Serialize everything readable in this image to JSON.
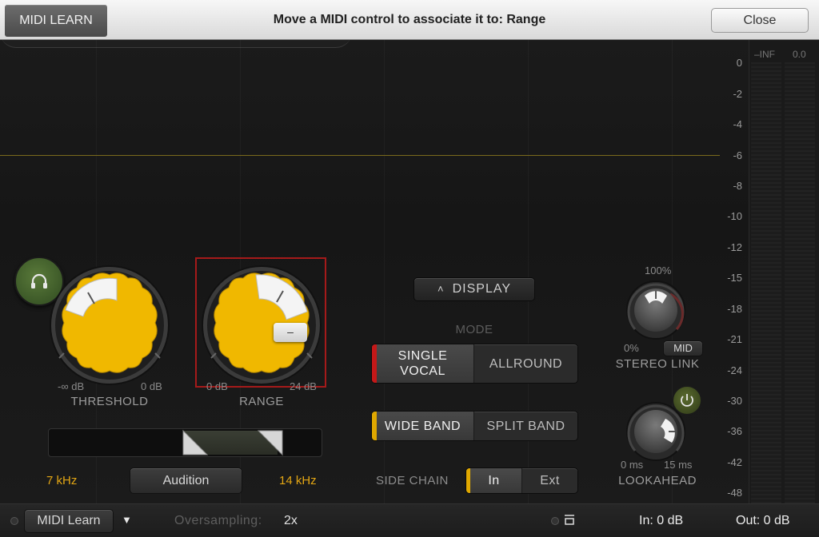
{
  "topbar": {
    "tab_label": "MIDI LEARN",
    "message": "Move a MIDI control to associate it to: Range",
    "close_label": "Close"
  },
  "meter": {
    "scale": [
      "0",
      "-2",
      "-4",
      "-6",
      "-8",
      "-10",
      "-12",
      "-15",
      "-18",
      "-21",
      "-24",
      "-30",
      "-36",
      "-42",
      "-48"
    ],
    "peak_left": "–INF",
    "peak_right": "0.0"
  },
  "threshold": {
    "label": "THRESHOLD",
    "min": "-∞ dB",
    "max": "0 dB"
  },
  "range": {
    "label": "RANGE",
    "min": "0 dB",
    "max": "24 dB",
    "tooltip": "–"
  },
  "frequency": {
    "low": "7 kHz",
    "high": "14 kHz",
    "audition_label": "Audition"
  },
  "display": {
    "label": "DISPLAY"
  },
  "mode": {
    "label": "MODE",
    "options": [
      "SINGLE VOCAL",
      "ALLROUND"
    ],
    "selected": "SINGLE VOCAL"
  },
  "band": {
    "options": [
      "WIDE BAND",
      "SPLIT BAND"
    ],
    "selected": "WIDE BAND"
  },
  "sidechain": {
    "label": "SIDE CHAIN",
    "options": [
      "In",
      "Ext"
    ],
    "selected": "In"
  },
  "stereo_link": {
    "label": "STEREO LINK",
    "min": "0%",
    "max": "100%",
    "mid_label": "MID"
  },
  "lookahead": {
    "label": "LOOKAHEAD",
    "min": "0 ms",
    "max": "15 ms"
  },
  "bottom": {
    "midi_learn_label": "MIDI Learn",
    "oversampling_label": "Oversampling:",
    "oversampling_value": "2x",
    "in_level": "In: 0 dB",
    "out_level": "Out: 0 dB"
  },
  "colors": {
    "accent": "#f0b800",
    "mode_indicator": "#c41818",
    "band_indicator": "#e0a800"
  }
}
